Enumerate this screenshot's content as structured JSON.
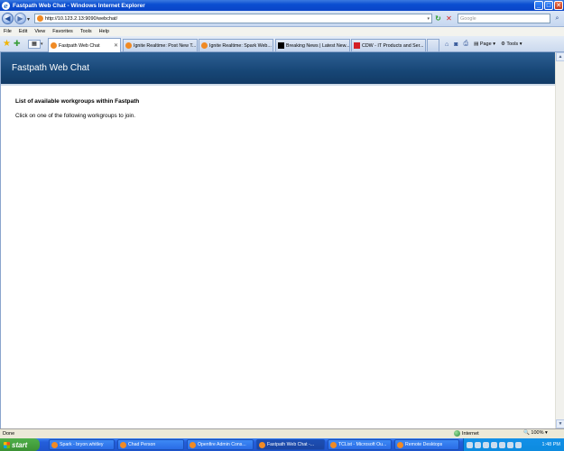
{
  "window": {
    "title": "Fastpath Web Chat - Windows Internet Explorer"
  },
  "address_bar": {
    "url": "http://10.123.2.13:9090/webchat/",
    "search_placeholder": "Google"
  },
  "menu": [
    "File",
    "Edit",
    "View",
    "Favorites",
    "Tools",
    "Help"
  ],
  "tabs": [
    {
      "label": "Fastpath Web Chat",
      "active": true
    },
    {
      "label": "Ignite Realtime: Post New T..."
    },
    {
      "label": "Ignite Realtime: Spark Web..."
    },
    {
      "label": "Breaking News | Latest New..."
    },
    {
      "label": "CDW - IT Products and Ser..."
    }
  ],
  "command_bar": {
    "page_label": "Page",
    "tools_label": "Tools"
  },
  "page": {
    "header_title": "Fastpath Web Chat",
    "heading": "List of available workgroups within Fastpath",
    "instruction": "Click on one of the following workgroups to join."
  },
  "status_bar": {
    "status": "Done",
    "zone": "Internet",
    "zoom": "100%"
  },
  "taskbar": {
    "start_label": "start",
    "items": [
      {
        "label": "Spark - bryon.whitley"
      },
      {
        "label": "Chad Person"
      },
      {
        "label": "Openfire Admin Cons..."
      },
      {
        "label": "Fastpath Web Chat -...",
        "active": true
      },
      {
        "label": "TCList - Microsoft Ou..."
      },
      {
        "label": "Remote Desktops"
      }
    ],
    "clock": "1:48 PM"
  }
}
